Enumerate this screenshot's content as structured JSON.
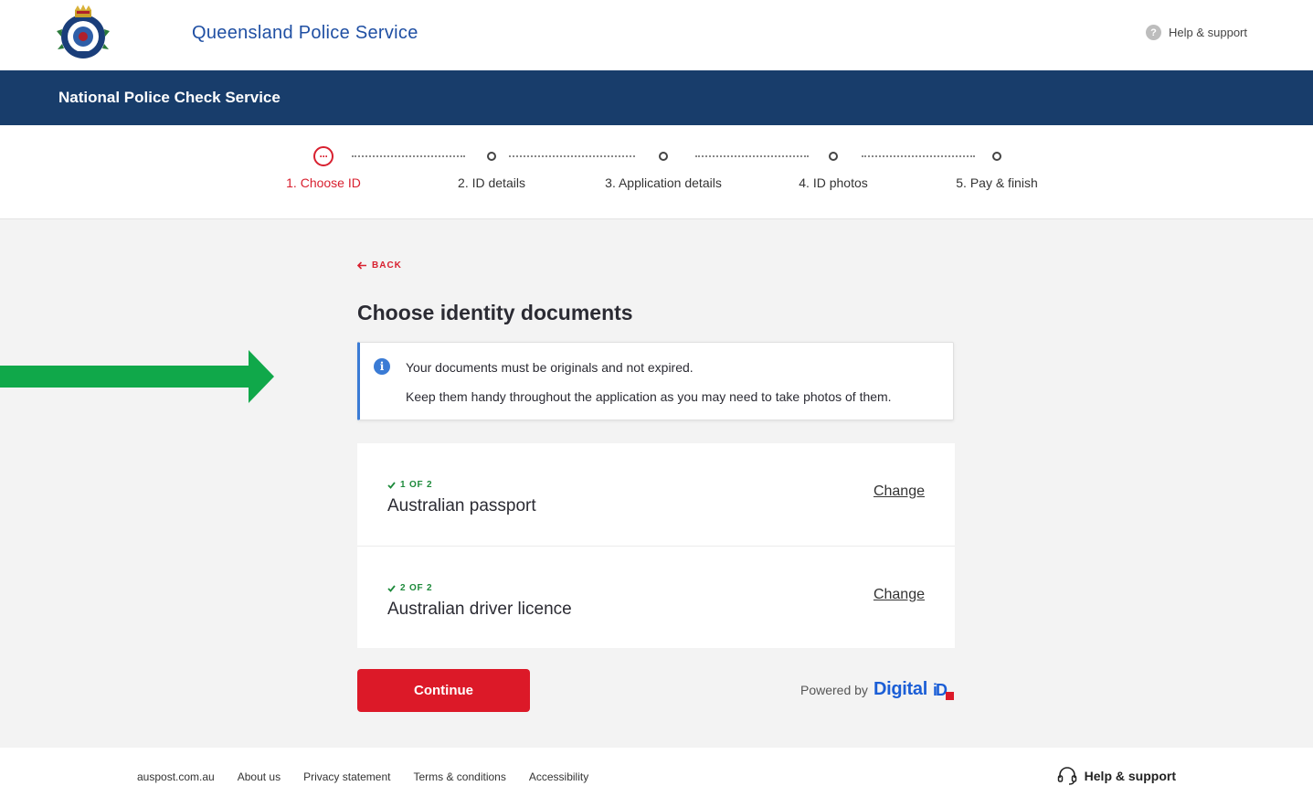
{
  "header": {
    "org_name": "Queensland Police Service",
    "help_label": "Help & support"
  },
  "banner": {
    "title": "National Police Check Service"
  },
  "stepper": {
    "active_index": 0,
    "steps": [
      {
        "label": "1. Choose ID"
      },
      {
        "label": "2. ID details"
      },
      {
        "label": "3. Application details"
      },
      {
        "label": "4. ID photos"
      },
      {
        "label": "5. Pay & finish"
      }
    ],
    "active_icon_glyph": "···"
  },
  "main": {
    "back_label": "BACK",
    "title": "Choose identity documents",
    "info": {
      "icon": "i",
      "line1": "Your documents must be originals and not expired.",
      "line2": "Keep them handy throughout the application as you may need to take photos of them."
    },
    "documents": [
      {
        "step": "1 OF 2",
        "name": "Australian passport",
        "change_label": "Change"
      },
      {
        "step": "2 OF 2",
        "name": "Australian driver licence",
        "change_label": "Change"
      }
    ],
    "continue_label": "Continue",
    "powered_by": {
      "prefix": "Powered by",
      "brand": "Digital",
      "brand_mark": "iD"
    }
  },
  "footer": {
    "links": [
      "auspost.com.au",
      "About us",
      "Privacy statement",
      "Terms & conditions",
      "Accessibility"
    ],
    "help_label": "Help & support"
  },
  "colors": {
    "brand_blue": "#183d6b",
    "accent_red": "#dc1928",
    "info_blue": "#3a7bd5",
    "success_green": "#1d8a3b",
    "annotation_arrow": "#10a84a"
  }
}
